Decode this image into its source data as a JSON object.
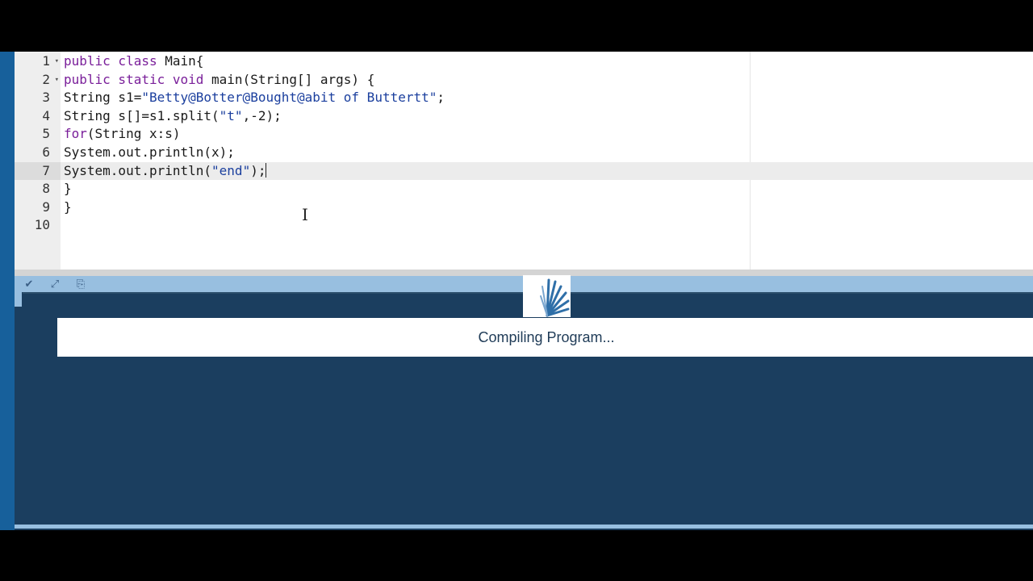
{
  "editor": {
    "lines": [
      {
        "num": "1",
        "fold": true,
        "text": [
          {
            "t": "public class ",
            "c": "kw"
          },
          {
            "t": "Main{",
            "c": "ty"
          }
        ]
      },
      {
        "num": "2",
        "fold": true,
        "text": [
          {
            "t": "public static void ",
            "c": "kw"
          },
          {
            "t": "main(String[] args) {",
            "c": "ty"
          }
        ]
      },
      {
        "num": "3",
        "fold": false,
        "text": [
          {
            "t": "String s1=",
            "c": "ty"
          },
          {
            "t": "\"Betty@Botter@Bought@abit of Buttertt\"",
            "c": "str"
          },
          {
            "t": ";",
            "c": "ty"
          }
        ]
      },
      {
        "num": "4",
        "fold": false,
        "text": [
          {
            "t": "String s[]=s1.split(",
            "c": "ty"
          },
          {
            "t": "\"t\"",
            "c": "str"
          },
          {
            "t": ",-2);",
            "c": "ty"
          }
        ]
      },
      {
        "num": "5",
        "fold": false,
        "text": [
          {
            "t": "for",
            "c": "kw"
          },
          {
            "t": "(String x:s)",
            "c": "ty"
          }
        ]
      },
      {
        "num": "6",
        "fold": false,
        "text": [
          {
            "t": "System.out.println(x);",
            "c": "ty"
          }
        ]
      },
      {
        "num": "7",
        "fold": false,
        "active": true,
        "text": [
          {
            "t": "System.out.println(",
            "c": "ty"
          },
          {
            "t": "\"end\"",
            "c": "str"
          },
          {
            "t": ");",
            "c": "ty"
          }
        ]
      },
      {
        "num": "8",
        "fold": false,
        "text": [
          {
            "t": "}",
            "c": "ty"
          }
        ]
      },
      {
        "num": "9",
        "fold": false,
        "text": [
          {
            "t": "}",
            "c": "ty"
          }
        ]
      },
      {
        "num": "10",
        "fold": false,
        "text": []
      }
    ]
  },
  "toolbar": {
    "buttons": [
      {
        "name": "collapse-output-button",
        "icon": "chevron-down-icon",
        "glyph": "✔"
      },
      {
        "name": "expand-output-button",
        "icon": "expand-arrows-icon",
        "glyph": "⤢"
      },
      {
        "name": "copy-output-button",
        "icon": "copy-icon",
        "glyph": "⎘"
      }
    ]
  },
  "output": {
    "status": "Compiling Program..."
  },
  "colors": {
    "frame_bg": "#1b3e5f",
    "toolbar_bg": "#98bfe0",
    "keyword": "#7a1f9a",
    "string": "#1b3f9e"
  }
}
